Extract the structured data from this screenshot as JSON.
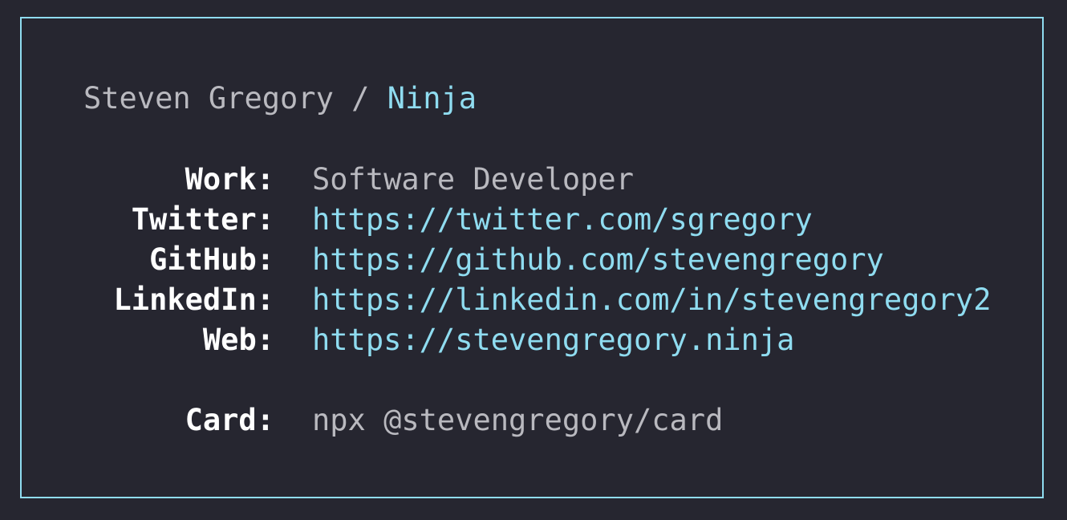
{
  "header": {
    "name": "Steven Gregory",
    "separator": " / ",
    "handle": "Ninja"
  },
  "rows": {
    "work": {
      "label": "Work:",
      "value": "Software Developer"
    },
    "twitter": {
      "label": "Twitter:",
      "value": "https://twitter.com/sgregory"
    },
    "github": {
      "label": "GitHub:",
      "value": "https://github.com/stevengregory"
    },
    "linkedin": {
      "label": "LinkedIn:",
      "value": "https://linkedin.com/in/stevengregory2"
    },
    "web": {
      "label": "Web:",
      "value": "https://stevengregory.ninja"
    },
    "card": {
      "label": "Card:",
      "value": "npx @stevengregory/card"
    }
  },
  "colors": {
    "background": "#262630",
    "border": "#8fdcf0",
    "accent": "#8fdcf0",
    "label": "#ffffff",
    "text": "#b9b9bf"
  }
}
